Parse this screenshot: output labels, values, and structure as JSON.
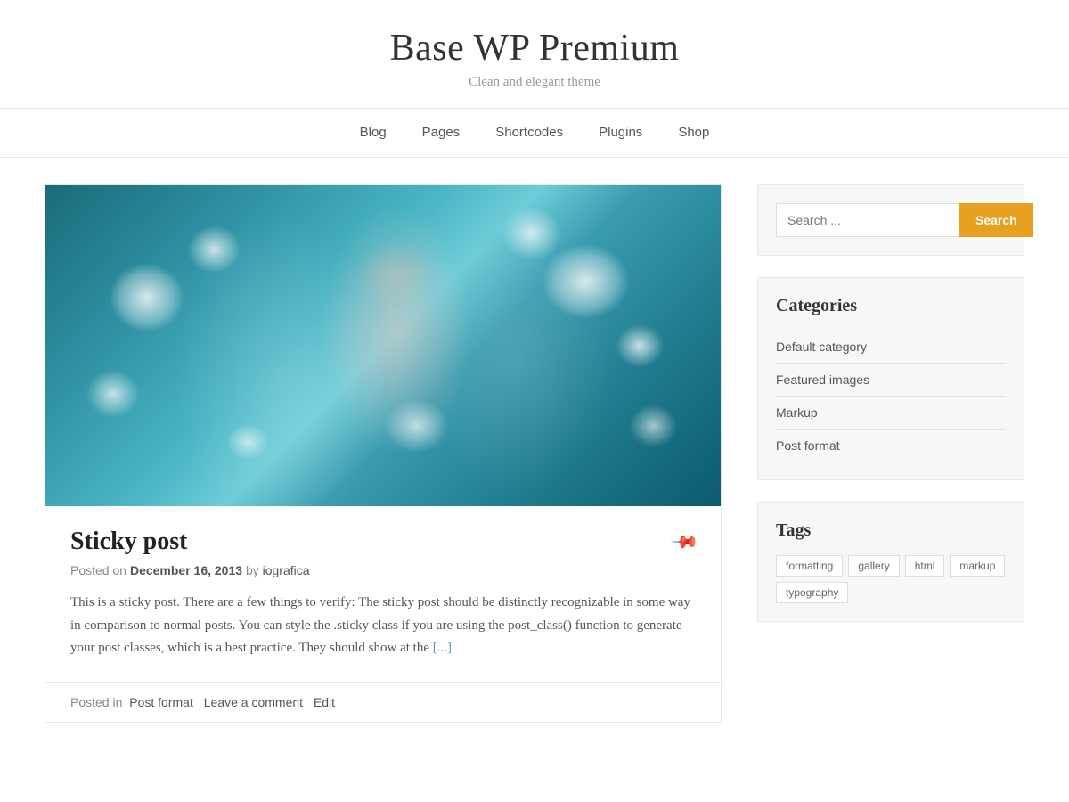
{
  "site": {
    "title": "Base WP Premium",
    "tagline": "Clean and elegant theme"
  },
  "nav": {
    "items": [
      {
        "label": "Blog",
        "href": "#"
      },
      {
        "label": "Pages",
        "href": "#"
      },
      {
        "label": "Shortcodes",
        "href": "#"
      },
      {
        "label": "Plugins",
        "href": "#"
      },
      {
        "label": "Shop",
        "href": "#"
      }
    ]
  },
  "post": {
    "title": "Sticky post",
    "meta_prefix": "Posted on",
    "date": "December 16, 2013",
    "author_prefix": "by",
    "author": "iografica",
    "excerpt": "This is a sticky post. There are a few things to verify: The sticky post should be distinctly recognizable in some way in comparison to normal posts. You can style the .sticky class if you are using the post_class() function to generate your post classes, which is a best practice. They should show at the",
    "excerpt_link": "[...]",
    "footer_posted_in": "Posted in",
    "footer_category": "Post format",
    "footer_comment": "Leave a comment",
    "footer_edit": "Edit"
  },
  "sidebar": {
    "search": {
      "placeholder": "Search ...",
      "button_label": "Search"
    },
    "categories": {
      "title": "Categories",
      "items": [
        {
          "label": "Default category"
        },
        {
          "label": "Featured images"
        },
        {
          "label": "Markup"
        },
        {
          "label": "Post format"
        }
      ]
    },
    "tags": {
      "title": "Tags",
      "items": [
        {
          "label": "formatting"
        },
        {
          "label": "gallery"
        },
        {
          "label": "html"
        },
        {
          "label": "markup"
        },
        {
          "label": "typography"
        }
      ]
    }
  },
  "colors": {
    "accent": "#e8a020",
    "link": "#4a9db5"
  }
}
